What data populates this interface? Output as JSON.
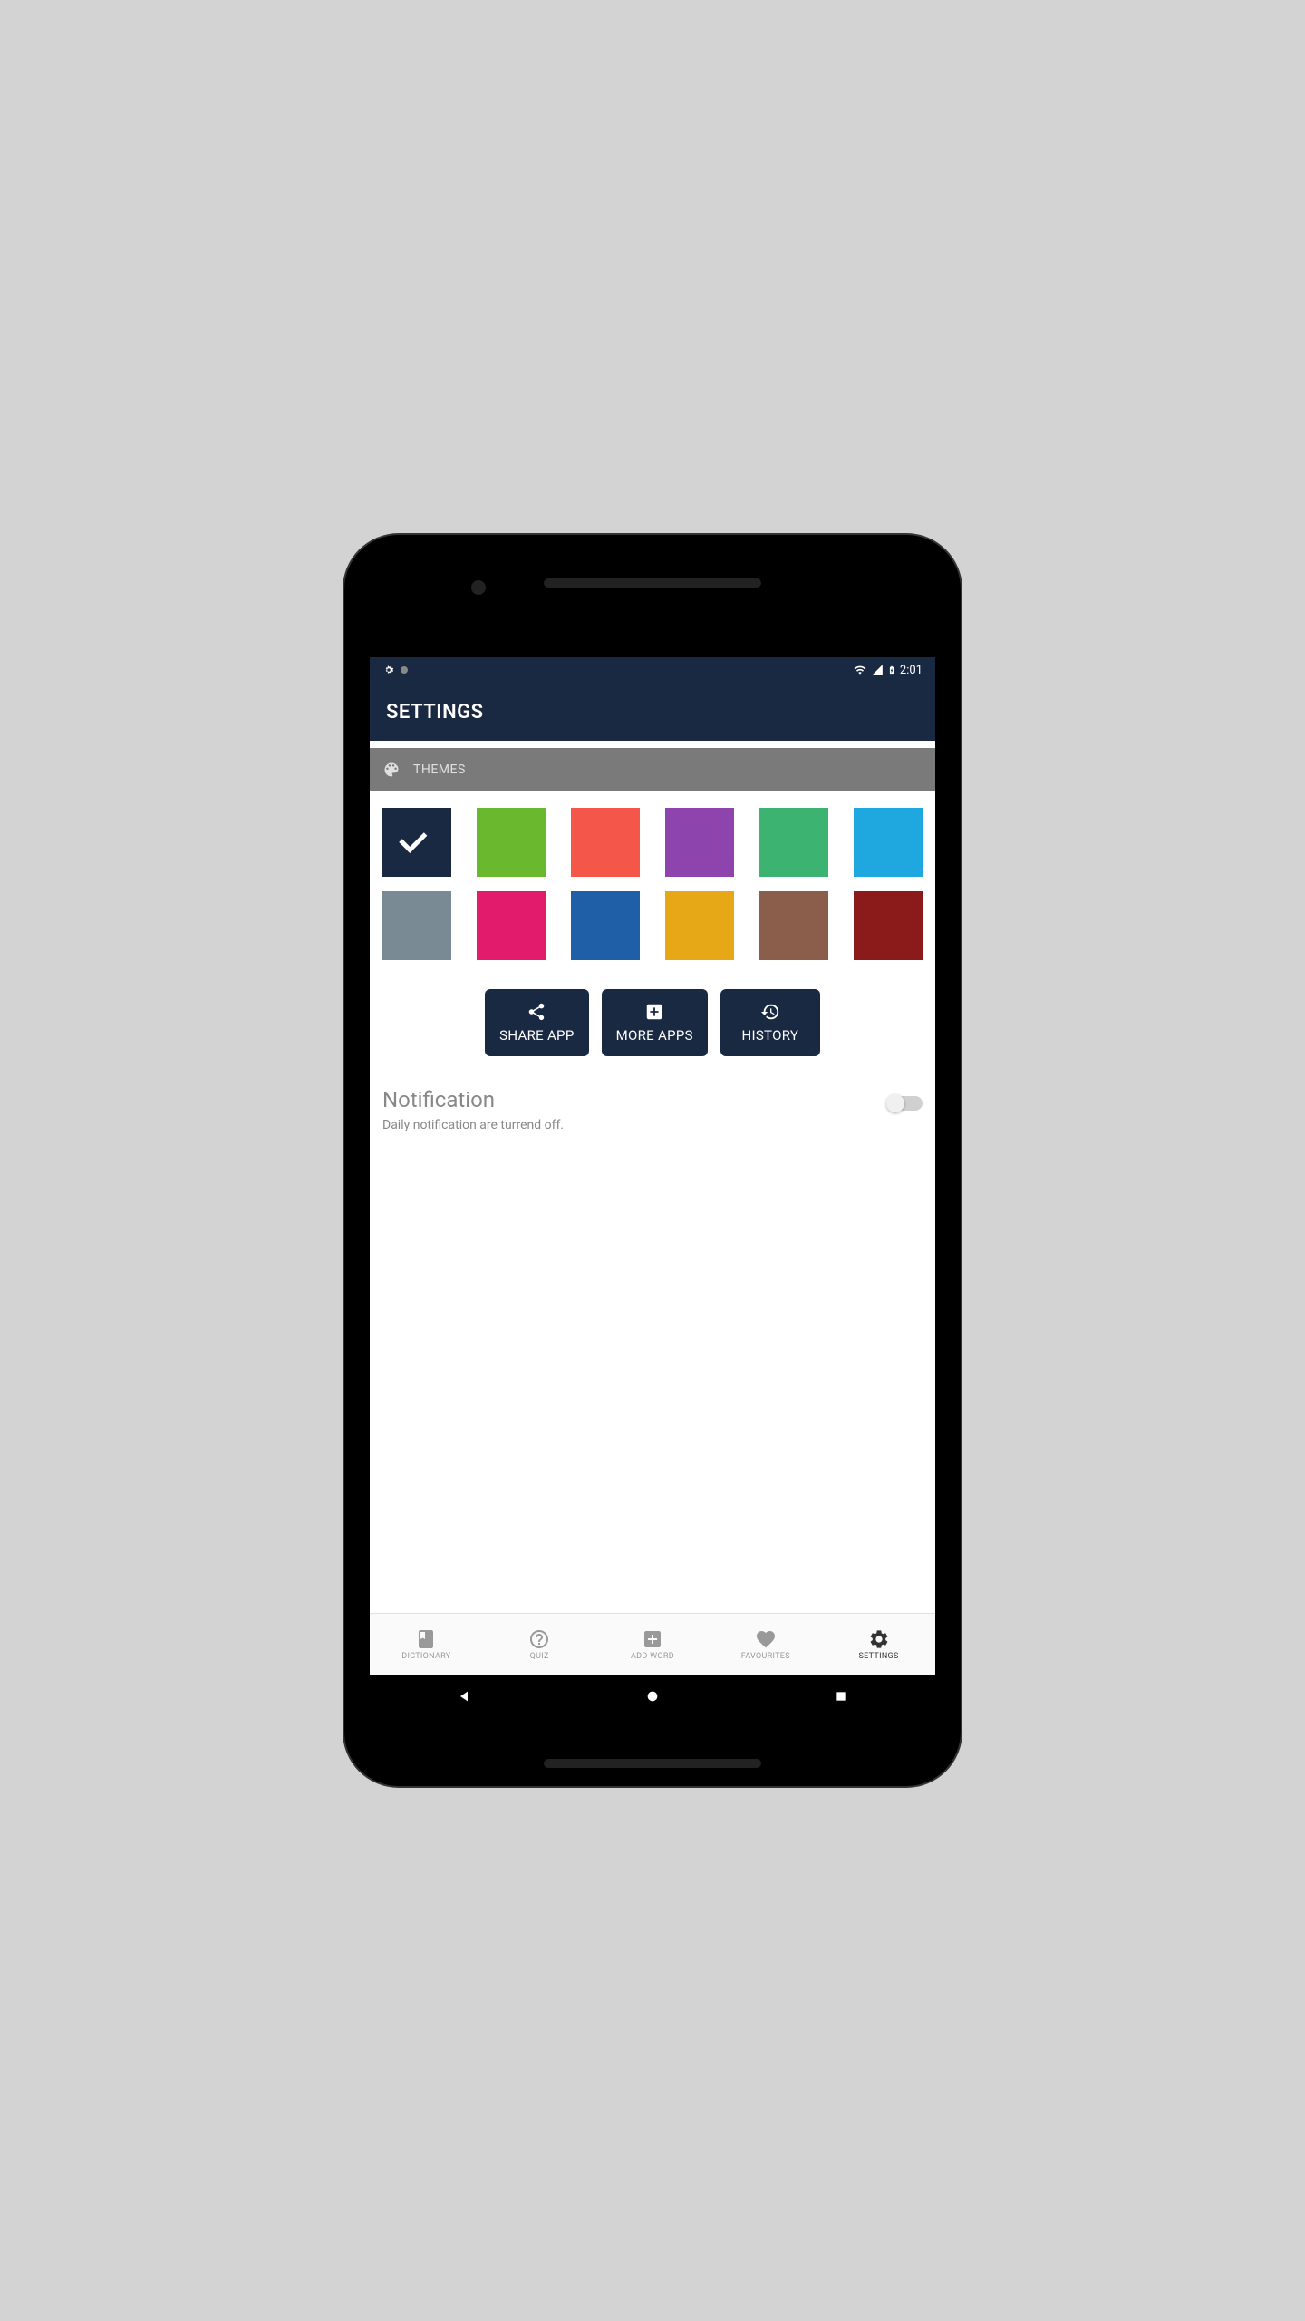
{
  "status_bar": {
    "time": "2:01"
  },
  "header": {
    "title": "SETTINGS"
  },
  "themes_section": {
    "label": "THEMES",
    "colors": [
      {
        "hex": "#1a2942",
        "selected": true
      },
      {
        "hex": "#6ab82e",
        "selected": false
      },
      {
        "hex": "#f4564a",
        "selected": false
      },
      {
        "hex": "#8e44ad",
        "selected": false
      },
      {
        "hex": "#3cb371",
        "selected": false
      },
      {
        "hex": "#1fa8e0",
        "selected": false
      },
      {
        "hex": "#7a8a94",
        "selected": false
      },
      {
        "hex": "#e31b6d",
        "selected": false
      },
      {
        "hex": "#1f5fa8",
        "selected": false
      },
      {
        "hex": "#e6a817",
        "selected": false
      },
      {
        "hex": "#8a5e4a",
        "selected": false
      },
      {
        "hex": "#8b1a1a",
        "selected": false
      }
    ]
  },
  "actions": {
    "share": "SHARE APP",
    "more": "MORE APPS",
    "history": "HISTORY"
  },
  "notification": {
    "title": "Notification",
    "subtitle": "Daily notification are turrend off.",
    "enabled": false
  },
  "bottom_nav": {
    "items": [
      {
        "label": "DICTIONARY",
        "icon": "book"
      },
      {
        "label": "QUIZ",
        "icon": "question"
      },
      {
        "label": "ADD WORD",
        "icon": "plus"
      },
      {
        "label": "FAVOURITES",
        "icon": "heart"
      },
      {
        "label": "SETTINGS",
        "icon": "gear"
      }
    ],
    "active_index": 4
  }
}
